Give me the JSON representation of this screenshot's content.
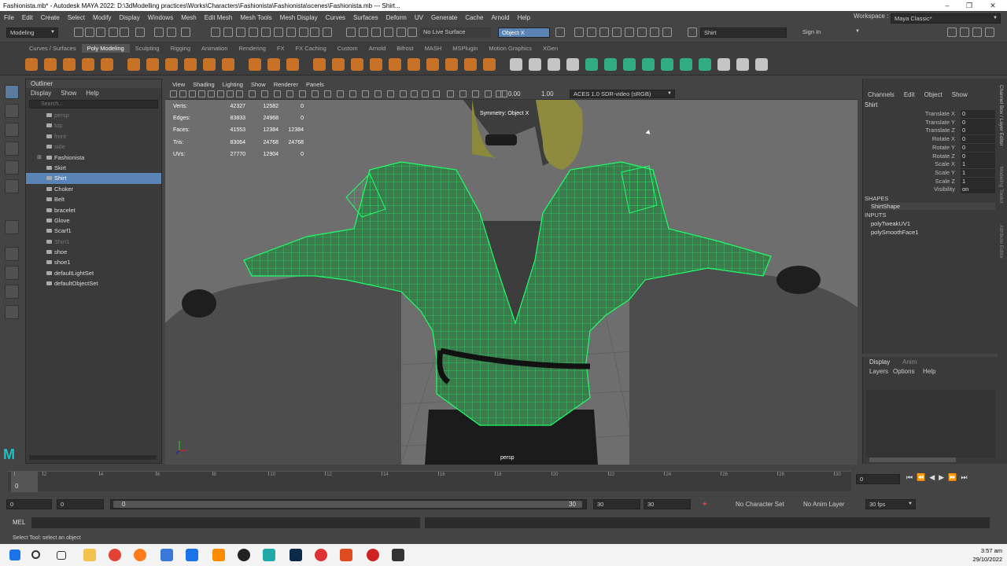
{
  "titlebar": {
    "title": "Fashionista.mb* - Autodesk MAYA 2022: D:\\3dModelling practices\\Works\\Characters\\Fashionista\\Fashionista\\scenes\\Fashionista.mb   ---   Shirt..."
  },
  "menubar": [
    "File",
    "Edit",
    "Create",
    "Select",
    "Modify",
    "Display",
    "Windows",
    "Mesh",
    "Edit Mesh",
    "Mesh Tools",
    "Mesh Display",
    "Curves",
    "Surfaces",
    "Deform",
    "UV",
    "Generate",
    "Cache",
    "Arnold",
    "Help"
  ],
  "workspace": {
    "label": "Workspace :",
    "value": "Maya Classic*"
  },
  "statusline": {
    "menuset": "Modeling",
    "live_surface": "No Live Surface",
    "symmetry": "Object X",
    "search_value": "Shirt",
    "sign_in": "Sign In"
  },
  "shelf_tabs": [
    "Curves / Surfaces",
    "Poly Modeling",
    "Sculpting",
    "Rigging",
    "Animation",
    "Rendering",
    "FX",
    "FX Caching",
    "Custom",
    "Arnold",
    "Bifrost",
    "MASH",
    "MSPlugin",
    "Motion Graphics",
    "XGen"
  ],
  "shelf_active": "Poly Modeling",
  "outliner": {
    "title": "Outliner",
    "menu": [
      "Display",
      "Show",
      "Help"
    ],
    "search_placeholder": "Search...",
    "items": [
      {
        "name": "persp",
        "dim": true,
        "group": false,
        "sel": false
      },
      {
        "name": "top",
        "dim": true,
        "group": false,
        "sel": false
      },
      {
        "name": "front",
        "dim": true,
        "group": false,
        "sel": false
      },
      {
        "name": "side",
        "dim": true,
        "group": false,
        "sel": false
      },
      {
        "name": "Fashionista",
        "dim": false,
        "group": true,
        "sel": false
      },
      {
        "name": "Skirt",
        "dim": false,
        "group": false,
        "sel": false
      },
      {
        "name": "Shirt",
        "dim": false,
        "group": false,
        "sel": true
      },
      {
        "name": "Choker",
        "dim": false,
        "group": false,
        "sel": false
      },
      {
        "name": "Belt",
        "dim": false,
        "group": false,
        "sel": false
      },
      {
        "name": "bracelet",
        "dim": false,
        "group": false,
        "sel": false
      },
      {
        "name": "Glove",
        "dim": false,
        "group": false,
        "sel": false
      },
      {
        "name": "Scarf1",
        "dim": false,
        "group": false,
        "sel": false
      },
      {
        "name": "Shirt1",
        "dim": true,
        "group": false,
        "sel": false
      },
      {
        "name": "shoe",
        "dim": false,
        "group": false,
        "sel": false
      },
      {
        "name": "shoe1",
        "dim": false,
        "group": false,
        "sel": false
      },
      {
        "name": "defaultLightSet",
        "dim": false,
        "group": false,
        "sel": false
      },
      {
        "name": "defaultObjectSet",
        "dim": false,
        "group": false,
        "sel": false
      }
    ]
  },
  "viewport": {
    "menu": [
      "View",
      "Shading",
      "Lighting",
      "Show",
      "Renderer",
      "Panels"
    ],
    "exposure": "0.00",
    "gamma": "1.00",
    "colorspace": "ACES 1.0 SDR-video (sRGB)",
    "camera": "persp",
    "symmetry_label": "Symmetry: Object X",
    "hud": [
      {
        "label": "Verts:",
        "a": "42327",
        "b": "12582",
        "c": "0"
      },
      {
        "label": "Edges:",
        "a": "83833",
        "b": "24968",
        "c": "0"
      },
      {
        "label": "Faces:",
        "a": "41553",
        "b": "12384",
        "c": "12384"
      },
      {
        "label": "Tris:",
        "a": "83064",
        "b": "24768",
        "c": "24768"
      },
      {
        "label": "UVs:",
        "a": "27770",
        "b": "12904",
        "c": "0"
      }
    ]
  },
  "channelbox": {
    "menu": [
      "Channels",
      "Edit",
      "Object",
      "Show"
    ],
    "object": "Shirt",
    "attrs": [
      {
        "name": "Translate X",
        "value": "0"
      },
      {
        "name": "Translate Y",
        "value": "0"
      },
      {
        "name": "Translate Z",
        "value": "0"
      },
      {
        "name": "Rotate X",
        "value": "0"
      },
      {
        "name": "Rotate Y",
        "value": "0"
      },
      {
        "name": "Rotate Z",
        "value": "0"
      },
      {
        "name": "Scale X",
        "value": "1"
      },
      {
        "name": "Scale Y",
        "value": "1"
      },
      {
        "name": "Scale Z",
        "value": "1"
      },
      {
        "name": "Visibility",
        "value": "on"
      }
    ],
    "shapes_header": "SHAPES",
    "shape": "ShirtShape",
    "inputs_header": "INPUTS",
    "inputs": [
      "polyTweakUV1",
      "polySmoothFace1"
    ]
  },
  "side_tabs": [
    "Channel Box / Layer Editor",
    "Modeling Toolkit",
    "Attribute Editor"
  ],
  "layer_editor": {
    "tabs": [
      "Display",
      "Anim"
    ],
    "menu": [
      "Layers",
      "Options",
      "Help"
    ]
  },
  "timeslider": {
    "ticks": [
      "1",
      "2",
      "4",
      "6",
      "8",
      "10",
      "12",
      "14",
      "16",
      "18",
      "20",
      "22",
      "24",
      "26",
      "28",
      "30"
    ],
    "current": "0",
    "frame_field": "0"
  },
  "range": {
    "start": "0",
    "anim_start": "0",
    "slider_start": "0",
    "slider_end": "30",
    "end": "30",
    "anim_end": "30",
    "character": "No Character Set",
    "anim_layer": "No Anim Layer",
    "fps": "30 fps"
  },
  "mel": {
    "label": "MEL"
  },
  "helpline": "Select Tool: select an object",
  "taskbar": {
    "time": "3:57 am",
    "date": "29/10/2022"
  }
}
